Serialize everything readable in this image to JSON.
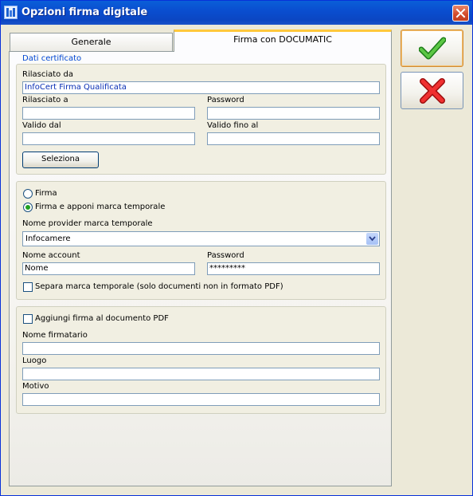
{
  "window": {
    "title": "Opzioni firma digitale"
  },
  "tabs": {
    "general": "Generale",
    "firma": "Firma con DOCUMATIC"
  },
  "certificate": {
    "legend": "Dati certificato",
    "issued_by_label": "Rilasciato da",
    "issued_by_value": "InfoCert Firma Qualificata",
    "issued_to_label": "Rilasciato a",
    "issued_to_value": "",
    "password_label": "Password",
    "password_value": "",
    "valid_from_label": "Valido dal",
    "valid_from_value": "",
    "valid_to_label": "Valido fino al",
    "valid_to_value": "",
    "select_button": "Seleziona"
  },
  "signature_mode": {
    "option_firma": "Firma",
    "option_firma_marca": "Firma e apponi marca temporale",
    "selected": "Firma e apponi marca temporale",
    "provider_label": "Nome provider marca temporale",
    "provider_value": "Infocamere",
    "account_label": "Nome account",
    "account_value": "Nome",
    "password_label": "Password",
    "password_value": "*********",
    "separate_label": "Separa marca temporale (solo documenti non in formato PDF)",
    "separate_checked": false
  },
  "pdf": {
    "add_signature_label": "Aggiungi firma al documento PDF",
    "add_signature_checked": false,
    "signer_label": "Nome firmatario",
    "signer_value": "",
    "place_label": "Luogo",
    "place_value": "",
    "reason_label": "Motivo",
    "reason_value": ""
  },
  "icons": {
    "ok": "checkmark-icon",
    "cancel": "x-icon",
    "close": "close-icon",
    "app": "app-icon",
    "dropdown": "chevron-down-icon"
  },
  "colors": {
    "titlebar": "#0a4ed0",
    "ok_green": "#2fa52a",
    "cancel_red": "#e02020",
    "tab_highlight": "#ffc83c"
  }
}
